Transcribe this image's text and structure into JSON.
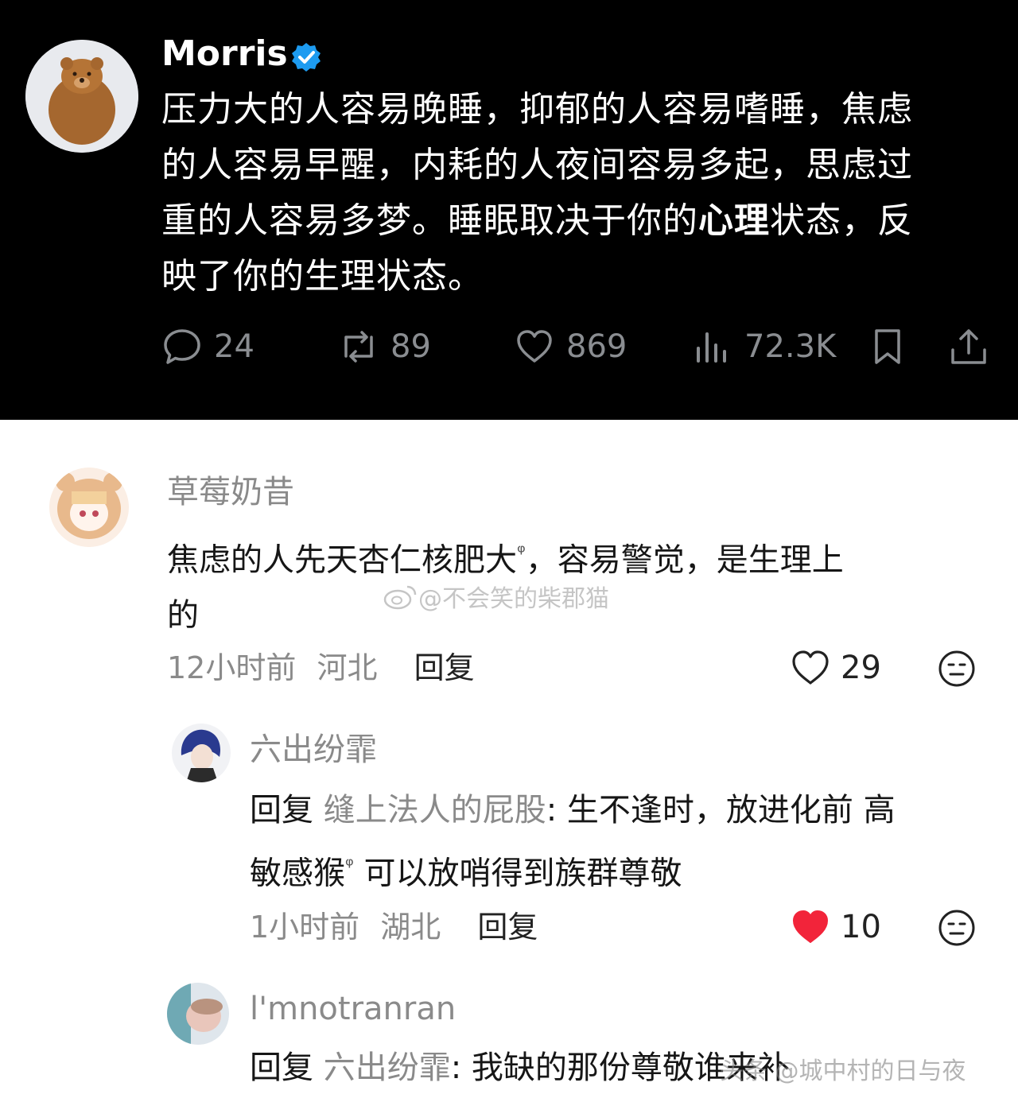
{
  "post": {
    "author": "Morris",
    "body_line1": "压力大的人容易晚睡，抑郁的人容易嗜睡，焦虑",
    "body_line2": "的人容易早醒，内耗的人夜间容易多起，思虑过",
    "body_line3_a": "重的人容易多梦。睡眠取决于你的",
    "body_line3_bold": "心理",
    "body_line3_b": "状态，反",
    "body_line4": "映了你的生理状态。",
    "metrics": {
      "replies": "24",
      "reposts": "89",
      "likes": "869",
      "views": "72.3K"
    },
    "icons": [
      "comment-icon",
      "repost-icon",
      "heart-icon",
      "views-icon",
      "bookmark-icon",
      "share-icon"
    ],
    "colors": {
      "background": "#000000",
      "verified": "#1d9bf0",
      "metric_gray": "#8a8d91"
    }
  },
  "comments": [
    {
      "user": "草莓奶昔",
      "text_line1": "焦虑的人先天杏仁核肥大",
      "search_mark": "ᵠ",
      "text_line1_b": "，容易警觉，是生理上",
      "text_line2": "的",
      "time": "12小时前",
      "location": "河北",
      "reply_label": "回复",
      "likes": "29",
      "liked": false
    },
    {
      "user": "六出纷霏",
      "reply_prefix": "回复",
      "reply_target": "缝上法人的屁股",
      "text_line1": ": 生不逢时，放进化前 高",
      "text_line2_a": "敏感猴",
      "search_mark": "ᵠ",
      "text_line2_b": " 可以放哨得到族群尊敬",
      "time": "1小时前",
      "location": "湖北",
      "reply_label": "回复",
      "likes": "10",
      "liked": true
    },
    {
      "user": "l'mnotranran",
      "reply_prefix": "回复",
      "reply_target": "六出纷霏",
      "text_line1": ": 我缺的那份尊敬谁来补"
    }
  ],
  "watermarks": {
    "center": "@不会笑的柴郡猫",
    "bottom": "头条 @城中村的日与夜"
  },
  "colors": {
    "like_red": "#f2243a",
    "text_gray": "#8a8a8a"
  }
}
